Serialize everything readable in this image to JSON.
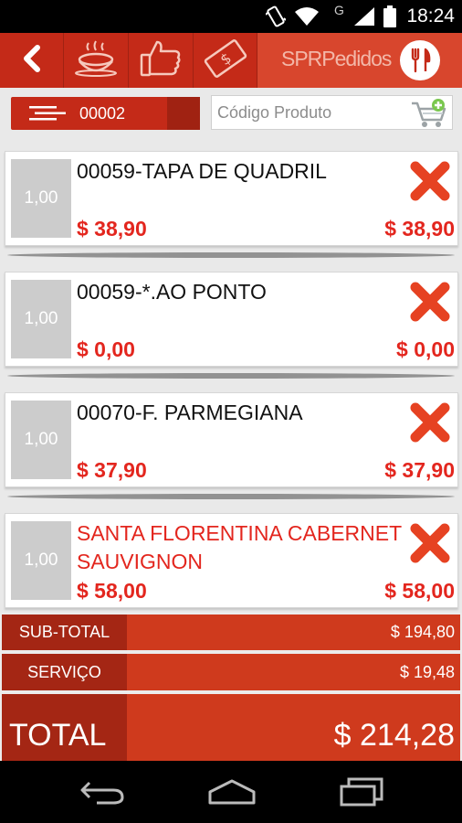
{
  "status_bar": {
    "time": "18:24",
    "network_letter": "G",
    "icons": [
      "vibrate-icon",
      "wifi-icon",
      "cell-signal-icon",
      "battery-icon"
    ]
  },
  "action_bar": {
    "brand": "SPRPedidos",
    "icons": [
      "back-icon",
      "dishes-icon",
      "thumbs-up-icon",
      "money-icon",
      "cutlery-icon"
    ]
  },
  "toolbar": {
    "order_number": "00002",
    "search_placeholder": "Código Produto"
  },
  "items": [
    {
      "qty": "1,00",
      "name": "00059-TAPA DE QUADRIL",
      "price": "$ 38,90",
      "total": "$ 38,90",
      "highlight": false
    },
    {
      "qty": "1,00",
      "name": "00059-*.AO PONTO",
      "price": "$ 0,00",
      "total": "$ 0,00",
      "highlight": false
    },
    {
      "qty": "1,00",
      "name": "00070-F. PARMEGIANA",
      "price": "$ 37,90",
      "total": "$ 37,90",
      "highlight": false
    },
    {
      "qty": "1,00",
      "name": "SANTA FLORENTINA CABERNET SAUVIGNON",
      "price": "$ 58,00",
      "total": "$ 58,00",
      "highlight": true
    }
  ],
  "totals": {
    "subtotal_label": "SUB-TOTAL",
    "subtotal_value": "$ 194,80",
    "service_label": "SERVIÇO",
    "service_value": "$ 19,48",
    "total_label": "TOTAL",
    "total_value": "$ 214,28"
  },
  "colors": {
    "accent": "#c42a18",
    "price_red": "#e3261e",
    "label_dark_red": "#a42614"
  }
}
